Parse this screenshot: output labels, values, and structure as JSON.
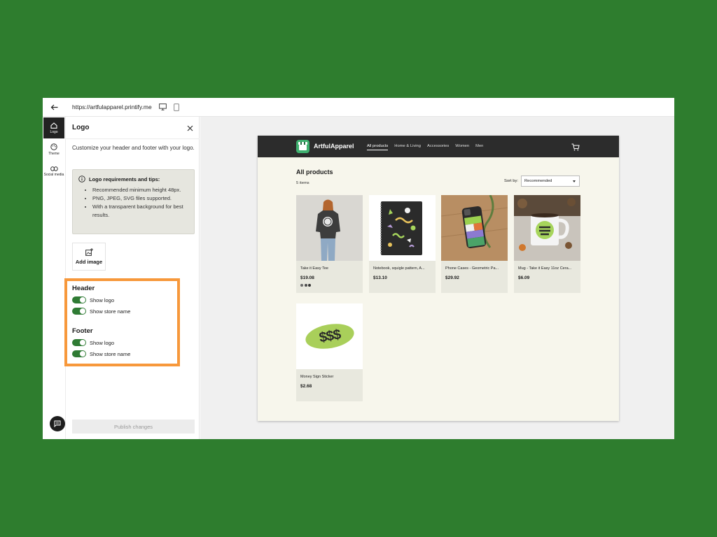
{
  "topbar": {
    "url": "https://artfulapparel.printify.me"
  },
  "rail": {
    "items": [
      {
        "label": "Logo"
      },
      {
        "label": "Theme"
      },
      {
        "label": "Social media"
      }
    ]
  },
  "panel": {
    "title": "Logo",
    "description": "Customize your header and footer with your logo.",
    "tips": {
      "heading": "Logo requirements and tips:",
      "items": [
        "Recommended minimum height 48px.",
        "PNG, JPEG, SVG files supported.",
        "With a transparent background for best results."
      ]
    },
    "add_image_label": "Add image",
    "header": {
      "title": "Header",
      "show_logo": "Show logo",
      "show_store_name": "Show store name"
    },
    "footer": {
      "title": "Footer",
      "show_logo": "Show logo",
      "show_store_name": "Show store name"
    },
    "publish_label": "Publish changes"
  },
  "store": {
    "name": "ArtfulApparel",
    "nav": [
      "All products",
      "Home & Living",
      "Accessories",
      "Women",
      "Men"
    ],
    "title": "All products",
    "count": "5 items",
    "sort_label": "Sort by:",
    "sort_value": "Recommended",
    "products": [
      {
        "name": "Take it Easy Tee",
        "price": "$19.08"
      },
      {
        "name": "Notebook, squigle pattern, A...",
        "price": "$13.10"
      },
      {
        "name": "Phone Cases - Geometric Pa...",
        "price": "$29.92"
      },
      {
        "name": "Mug - Take it Easy 11oz Cera...",
        "price": "$6.09"
      },
      {
        "name": "Money Sign Sticker",
        "price": "$2.68"
      }
    ],
    "sticker_text": "$$$"
  },
  "colors": {
    "background": "#2e7d2e",
    "highlight": "#f7983b",
    "toggle_on": "#2f7b34",
    "store_header": "#2c2c2c"
  }
}
